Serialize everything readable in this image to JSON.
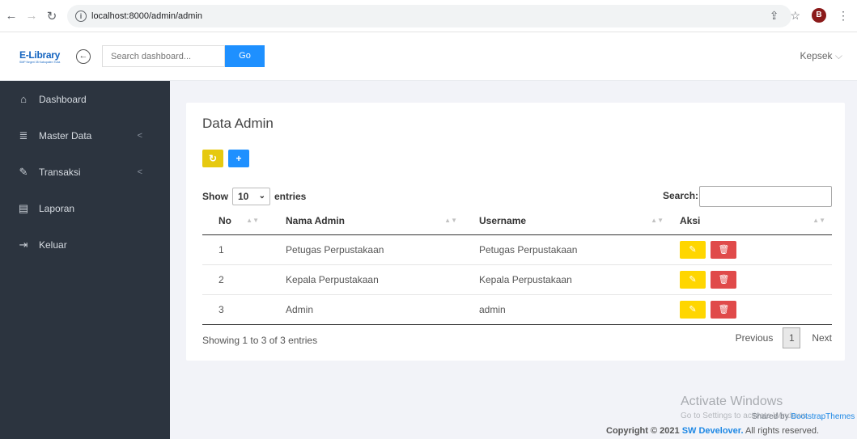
{
  "browser": {
    "url": "localhost:8000/admin/admin",
    "profile_initial": "B"
  },
  "header": {
    "logo_title": "E-Library",
    "logo_subtitle": "SMP Negeri 35 Kabupaten Tuba",
    "search_placeholder": "Search dashboard...",
    "go_label": "Go",
    "user_name": "Kepsek"
  },
  "sidebar": {
    "items": [
      {
        "label": "Dashboard",
        "icon": "home-icon"
      },
      {
        "label": "Master Data",
        "icon": "database-icon"
      },
      {
        "label": "Transaksi",
        "icon": "pencil-icon"
      },
      {
        "label": "Laporan",
        "icon": "report-icon"
      },
      {
        "label": "Keluar",
        "icon": "logout-icon"
      }
    ]
  },
  "main": {
    "title": "Data Admin",
    "show_label": "Show",
    "entries_value": "10",
    "entries_label": "entries",
    "search_label": "Search:",
    "columns": [
      "No",
      "Nama Admin",
      "Username",
      "Aksi"
    ],
    "rows": [
      {
        "no": "1",
        "nama": "Petugas Perpustakaan",
        "username": "Petugas Perpustakaan"
      },
      {
        "no": "2",
        "nama": "Kepala Perpustakaan",
        "username": "Kepala Perpustakaan"
      },
      {
        "no": "3",
        "nama": "Admin",
        "username": "admin"
      }
    ],
    "showing_text": "Showing 1 to 3 of 3 entries",
    "pagination": {
      "previous": "Previous",
      "page": "1",
      "next": "Next"
    }
  },
  "footer": {
    "activate_title": "Activate Windows",
    "activate_sub": "Go to Settings to activate Windows.",
    "shared_prefix": "Shared by ",
    "shared_brand": "BootstrapThemes",
    "copyright_prefix": "Copyright © 2021 ",
    "copyright_brand": "SW Develover.",
    "copyright_suffix": " All rights reserved."
  },
  "colors": {
    "sidebar_bg": "#2c343f",
    "primary": "#1e90ff",
    "warning": "#ffd600",
    "danger": "#e04a4a"
  }
}
